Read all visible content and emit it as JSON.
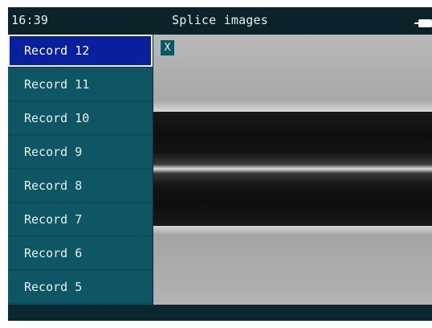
{
  "status_bar": {
    "time": "16:39",
    "title": "Splice images",
    "battery_icon": "battery-icon"
  },
  "sidebar": {
    "items": [
      {
        "label": "Record 12",
        "selected": true
      },
      {
        "label": "Record 11",
        "selected": false
      },
      {
        "label": "Record 10",
        "selected": false
      },
      {
        "label": "Record 9",
        "selected": false
      },
      {
        "label": "Record 8",
        "selected": false
      },
      {
        "label": "Record 7",
        "selected": false
      },
      {
        "label": "Record 6",
        "selected": false
      },
      {
        "label": "Record 5",
        "selected": false
      }
    ]
  },
  "image_view": {
    "close_label": "X"
  },
  "colors": {
    "selected_item": "#0a1f9c",
    "item_background": "#0e5664",
    "title_bar": "#0b2228"
  }
}
